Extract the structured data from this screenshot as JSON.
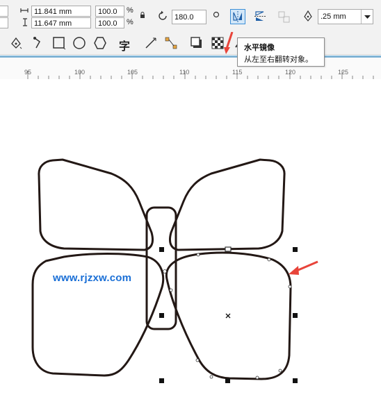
{
  "property_bar": {
    "width_value": "11.841 mm",
    "height_value": "11.647 mm",
    "scale_x": "100.0",
    "scale_y": "100.0",
    "percent_x": "%",
    "percent_y": "%",
    "rotation": "180.0",
    "outline_width": ".25 mm"
  },
  "tooltip": {
    "title": "水平镜像",
    "description": "从左至右翻转对象。"
  },
  "ruler": {
    "labels": [
      "95",
      "100",
      "105",
      "110",
      "115",
      "120",
      "125"
    ]
  },
  "toolbar": {
    "text_tool_glyph": "字"
  },
  "watermark": "www.rjzxw.com",
  "accent_color": "#e8443a"
}
